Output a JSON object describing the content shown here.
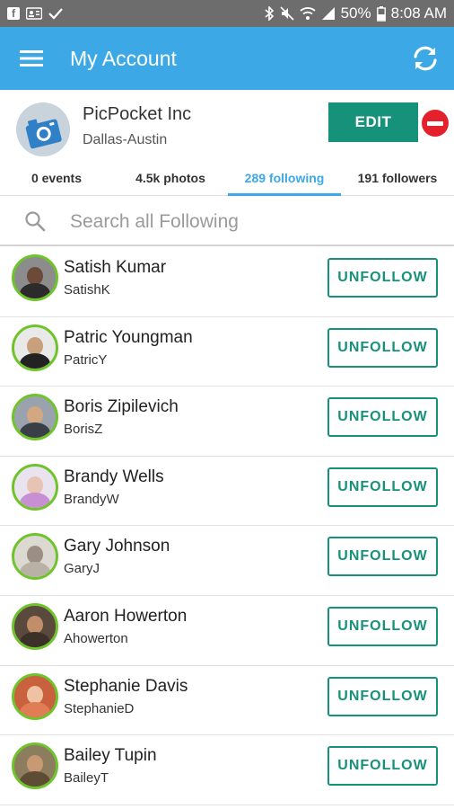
{
  "status_bar": {
    "time": "8:08 AM",
    "battery": "50%",
    "icons": [
      "facebook-icon",
      "contacts-icon",
      "check-icon",
      "bluetooth-icon",
      "mute-icon",
      "wifi-icon",
      "signal-icon",
      "battery-icon"
    ]
  },
  "app_bar": {
    "title": "My Account",
    "menu_icon": "hamburger-menu-icon",
    "refresh_icon": "refresh-icon",
    "color": "#3ca9e6"
  },
  "profile": {
    "name": "PicPocket Inc",
    "location": "Dallas-Austin",
    "edit_label": "EDIT",
    "remove_icon": "remove-circle-icon",
    "edit_color": "#16927a"
  },
  "tabs": [
    {
      "label": "0 events",
      "active": false
    },
    {
      "label": "4.5k photos",
      "active": false
    },
    {
      "label": "289 following",
      "active": true
    },
    {
      "label": "191 followers",
      "active": false
    }
  ],
  "search": {
    "placeholder": "Search all Following",
    "value": ""
  },
  "following": {
    "button_label": "UNFOLLOW",
    "users": [
      {
        "name": "Satish Kumar",
        "handle": "SatishK",
        "face": "#6b4a3a",
        "bg": "#8c8c8c",
        "shirt": "#2b2b2b"
      },
      {
        "name": "Patric Youngman",
        "handle": "PatricY",
        "face": "#c9a07c",
        "bg": "#e9e9e9",
        "shirt": "#222222"
      },
      {
        "name": "Boris Zipilevich",
        "handle": "BorisZ",
        "face": "#d2a882",
        "bg": "#9aa3ad",
        "shirt": "#3a3f47"
      },
      {
        "name": "Brandy Wells",
        "handle": "BrandyW",
        "face": "#e6c3b5",
        "bg": "#e9e3ef",
        "shirt": "#c98fd3"
      },
      {
        "name": "Gary Johnson",
        "handle": "GaryJ",
        "face": "#9b8f83",
        "bg": "#dcd8d2",
        "shirt": "#b9b1a6"
      },
      {
        "name": "Aaron Howerton",
        "handle": "Ahowerton",
        "face": "#c28e6a",
        "bg": "#5a4a3e",
        "shirt": "#3b3129"
      },
      {
        "name": "Stephanie Davis",
        "handle": "StephanieD",
        "face": "#efc2a4",
        "bg": "#c9613e",
        "shirt": "#e07d55"
      },
      {
        "name": "Bailey Tupin",
        "handle": "BaileyT",
        "face": "#c89a73",
        "bg": "#8d7d5f",
        "shirt": "#5e4c34"
      }
    ]
  }
}
